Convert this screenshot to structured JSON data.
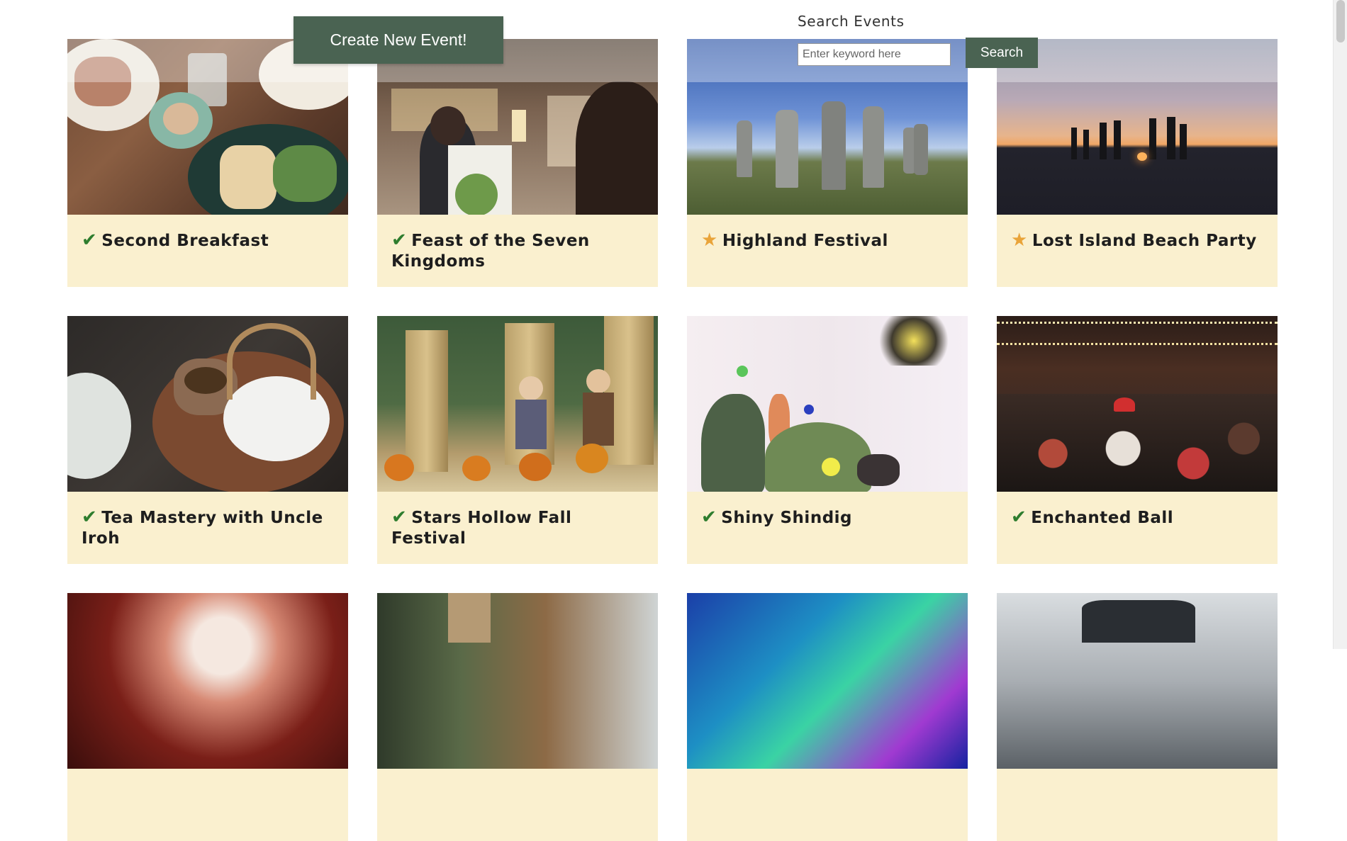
{
  "header": {
    "create_button_label": "Create New Event!",
    "search_heading": "Search Events",
    "search_placeholder": "Enter keyword here",
    "search_value": "",
    "search_button_label": "Search"
  },
  "events": [
    {
      "title": "Second Breakfast",
      "status": "attending",
      "status_icon": "✔",
      "image": "breakfast-table-photo"
    },
    {
      "title": "Feast of the Seven Kingdoms",
      "status": "attending",
      "status_icon": "✔",
      "image": "banquet-toast-photo"
    },
    {
      "title": "Highland Festival",
      "status": "starred",
      "status_icon": "★",
      "image": "standing-stones-photo"
    },
    {
      "title": "Lost Island Beach Party",
      "status": "starred",
      "status_icon": "★",
      "image": "beach-sunset-photo"
    },
    {
      "title": "Tea Mastery with Uncle Iroh",
      "status": "attending",
      "status_icon": "✔",
      "image": "teapot-photo"
    },
    {
      "title": "Stars Hollow Fall Festival",
      "status": "attending",
      "status_icon": "✔",
      "image": "scarecrows-pumpkins-photo"
    },
    {
      "title": "Shiny Shindig",
      "status": "attending",
      "status_icon": "✔",
      "image": "toy-dinosaurs-party-photo"
    },
    {
      "title": "Enchanted Ball",
      "status": "attending",
      "status_icon": "✔",
      "image": "crowd-string-lights-photo"
    },
    {
      "title": "",
      "status": "",
      "status_icon": "",
      "image": "concert-stage-photo"
    },
    {
      "title": "",
      "status": "",
      "status_icon": "",
      "image": "market-stall-photo"
    },
    {
      "title": "",
      "status": "",
      "status_icon": "",
      "image": "neon-lights-photo"
    },
    {
      "title": "",
      "status": "",
      "status_icon": "",
      "image": "snowy-castle-photo"
    }
  ],
  "colors": {
    "accent": "#4a6352",
    "card_background": "#faf0cf",
    "check_green": "#2e7d2e",
    "star_orange": "#e9a43a"
  }
}
